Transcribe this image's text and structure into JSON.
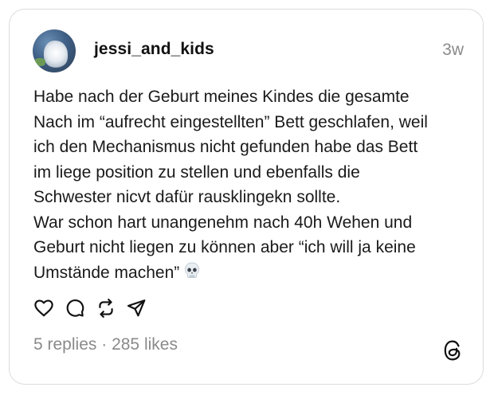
{
  "post": {
    "username": "jessi_and_kids",
    "time_ago": "3w",
    "text_lines": [
      "Habe nach der Geburt meines Kindes die gesamte",
      "Nach im “aufrecht eingestellten” Bett geschlafen, weil",
      "ich den Mechanismus nicht gefunden habe das Bett",
      "im liege position zu stellen und ebenfalls die",
      "Schwester nicvt dafür rausklingekn sollte.",
      "War schon hart unangenehm nach 40h Wehen und",
      "Geburt nicht liegen zu können aber “ich will ja keine",
      "Umstände machen”"
    ],
    "emoji": "skull-emoji",
    "replies": "5 replies",
    "separator": "·",
    "likes": "285 likes"
  },
  "icons": {
    "like": "heart-icon",
    "reply": "comment-icon",
    "repost": "repost-icon",
    "share": "send-icon",
    "brand": "threads-logo-icon"
  },
  "colors": {
    "text": "#1a1a1a",
    "muted": "#8a8a8a",
    "border": "#dcdcdc"
  }
}
